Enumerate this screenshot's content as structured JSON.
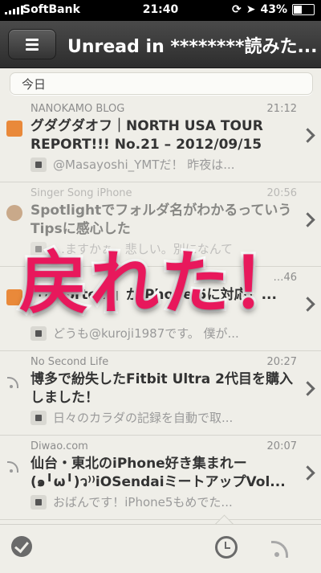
{
  "status": {
    "carrier": "SoftBank",
    "time": "21:40",
    "battery": "43%",
    "battery_level": 0.43
  },
  "nav": {
    "title": "Unread in ********読みた..."
  },
  "section": {
    "label": "今日"
  },
  "items": [
    {
      "source": "NANOKAMO BLOG",
      "time": "21:12",
      "title": "グダグダオフ｜NORTH USA TOUR REPORT!!! No.21 – 2012/09/15",
      "summary": "@Masayoshi_YMTだ！ 昨夜は...",
      "icon": "blog-icon"
    },
    {
      "source": "Singer Song iPhone",
      "time": "20:56",
      "title": "Spotlightでフォルダ名がわかるっていうTipsに感心した",
      "summary": "…ますかぁ。悲しい。別になんて",
      "icon": "avatar-icon"
    },
    {
      "source": "",
      "time": "…46",
      "title": "「tmbrtext」がiPhone 5に対応！...",
      "summary": "どうも@kuroji1987です。 僕が...",
      "icon": "blog-icon"
    },
    {
      "source": "No Second Life",
      "time": "20:27",
      "title": "博多で紛失したFitbit Ultra  2代目を購入しました！",
      "summary": "日々のカラダの記録を自動で取...",
      "icon": "feed-icon"
    },
    {
      "source": "Diwao.com",
      "time": "20:07",
      "title": "仙台・東北のiPhone好き集まれー(๑╹ω╹)ว⁾⁾iOSendaiミートアップVol...",
      "summary": "おばんです！iPhone5もめでた...",
      "icon": "feed-icon"
    }
  ],
  "overlay": {
    "text": "戻れた！"
  },
  "colors": {
    "overlay": "#e8185c",
    "navbar": "#3a3a3a",
    "background": "#efeee8"
  }
}
